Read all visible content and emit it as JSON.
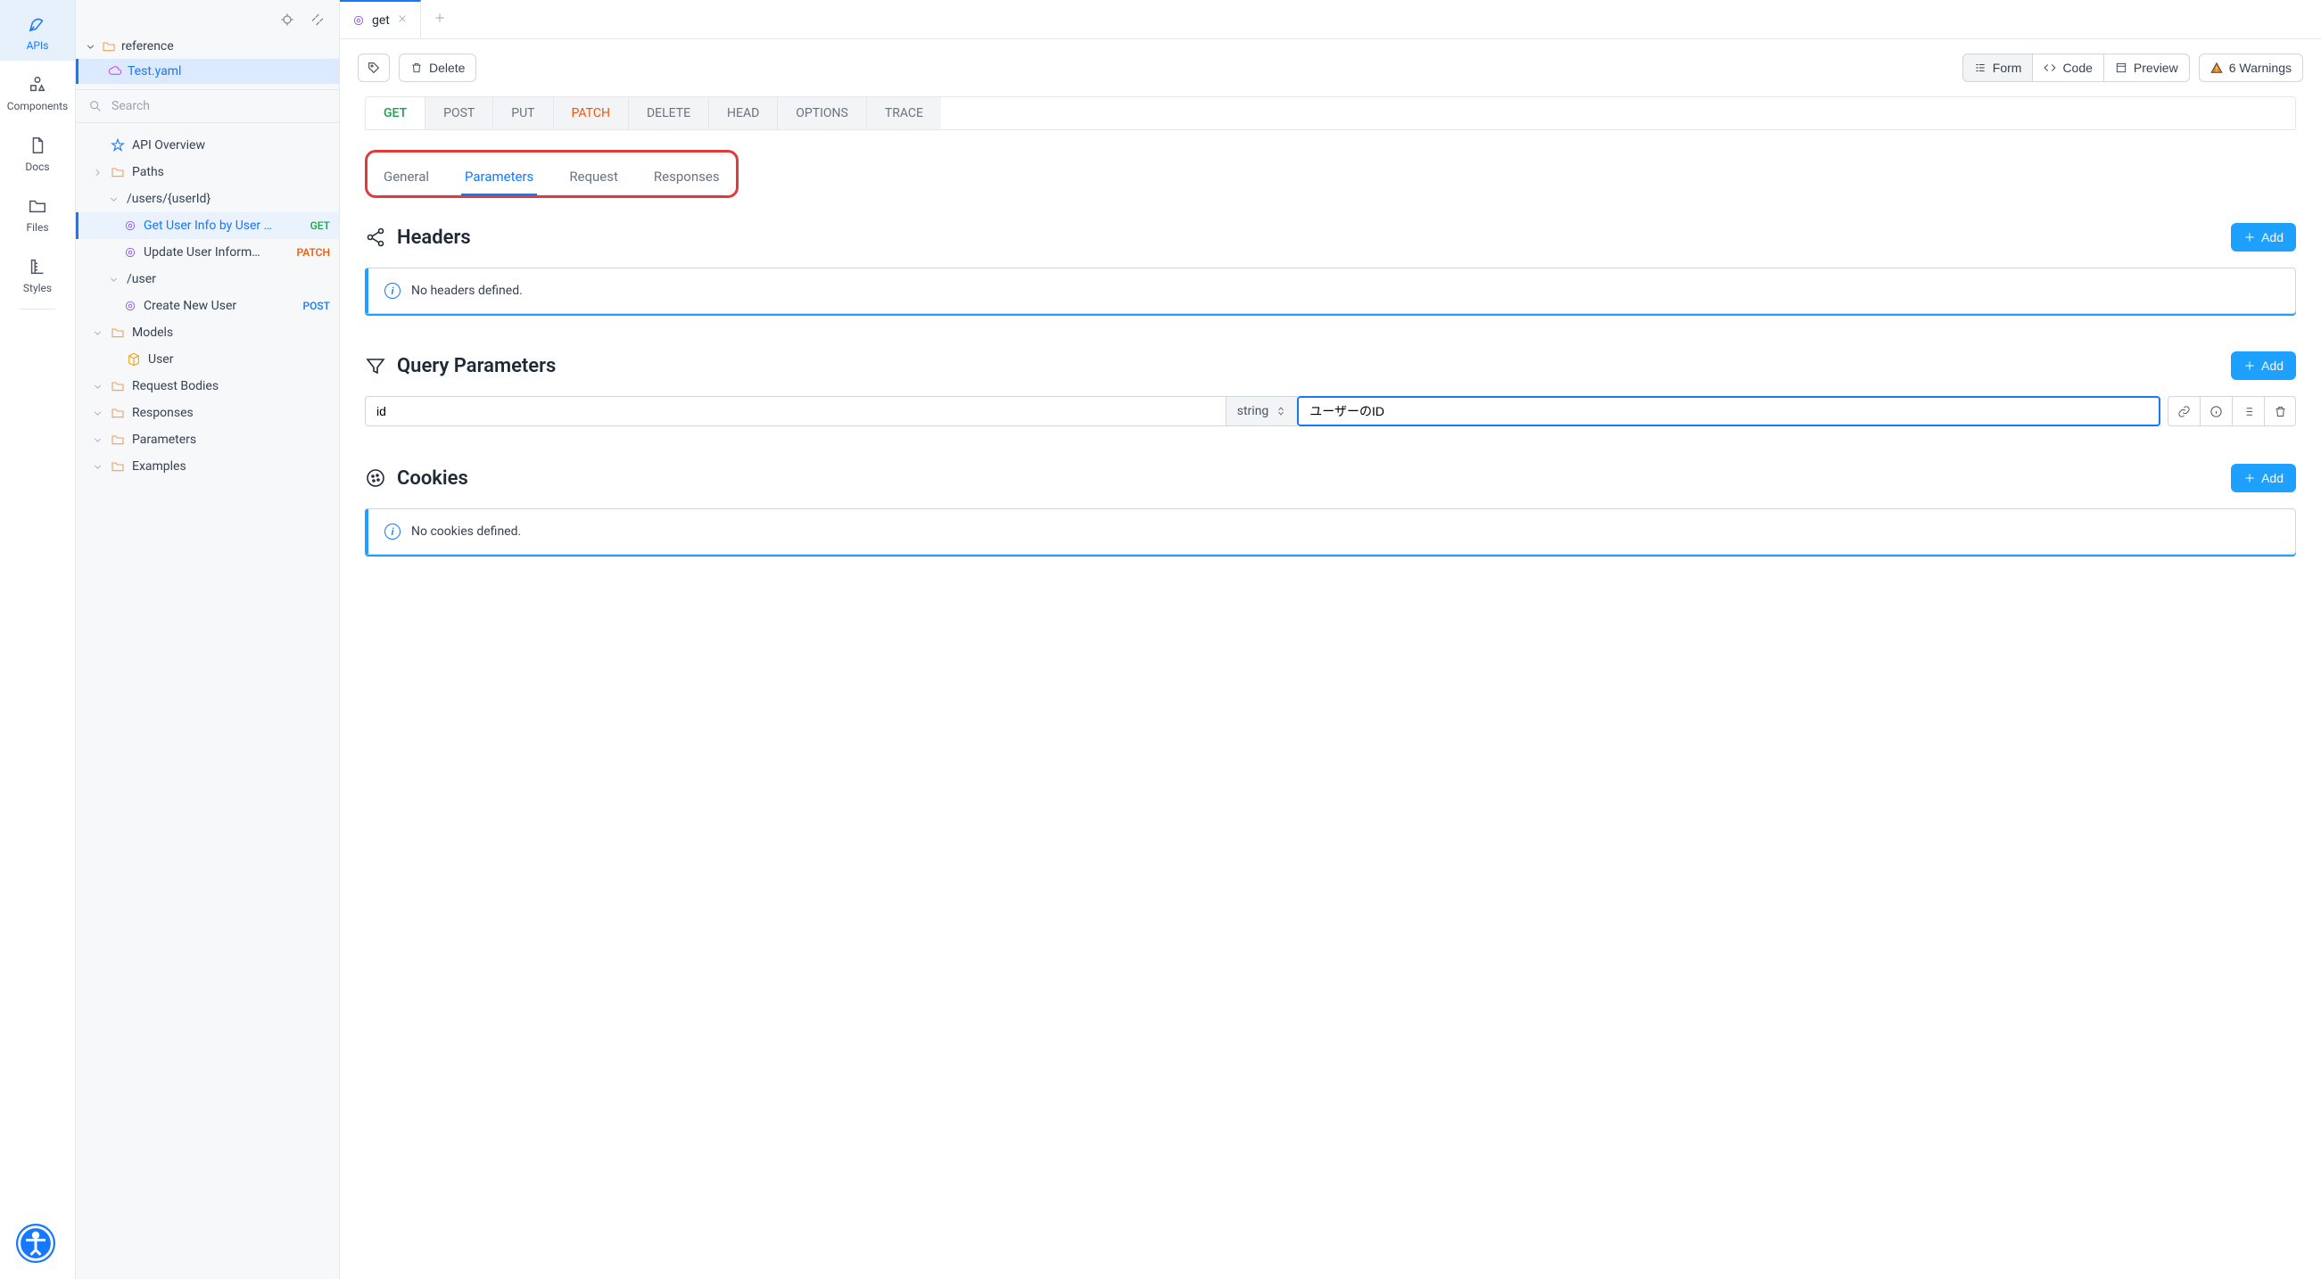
{
  "rail": {
    "items": [
      {
        "label": "APIs"
      },
      {
        "label": "Components"
      },
      {
        "label": "Docs"
      },
      {
        "label": "Files"
      },
      {
        "label": "Styles"
      }
    ]
  },
  "sidebar": {
    "root_folder": "reference",
    "file": "Test.yaml",
    "search_placeholder": "Search",
    "overview": "API Overview",
    "paths_label": "Paths",
    "path1": "/users/{userId}",
    "op1_label": "Get User Info by User …",
    "op1_method": "GET",
    "op2_label": "Update User Inform…",
    "op2_method": "PATCH",
    "path2": "/user",
    "op3_label": "Create New User",
    "op3_method": "POST",
    "models_label": "Models",
    "model1": "User",
    "reqbodies": "Request Bodies",
    "responses": "Responses",
    "parameters": "Parameters",
    "examples": "Examples"
  },
  "tab": {
    "label": "get"
  },
  "toolbar": {
    "delete": "Delete",
    "form": "Form",
    "code": "Code",
    "preview": "Preview",
    "warnings": "6 Warnings"
  },
  "methods": {
    "get": "GET",
    "post": "POST",
    "put": "PUT",
    "patch": "PATCH",
    "delete": "DELETE",
    "head": "HEAD",
    "options": "OPTIONS",
    "trace": "TRACE"
  },
  "subtabs": {
    "general": "General",
    "parameters": "Parameters",
    "request": "Request",
    "responses": "Responses"
  },
  "sections": {
    "headers_title": "Headers",
    "headers_empty": "No headers defined.",
    "query_title": "Query Parameters",
    "cookies_title": "Cookies",
    "cookies_empty": "No cookies defined.",
    "add": "Add"
  },
  "query_param": {
    "name": "id",
    "type": "string",
    "description": "ユーザーのID"
  }
}
